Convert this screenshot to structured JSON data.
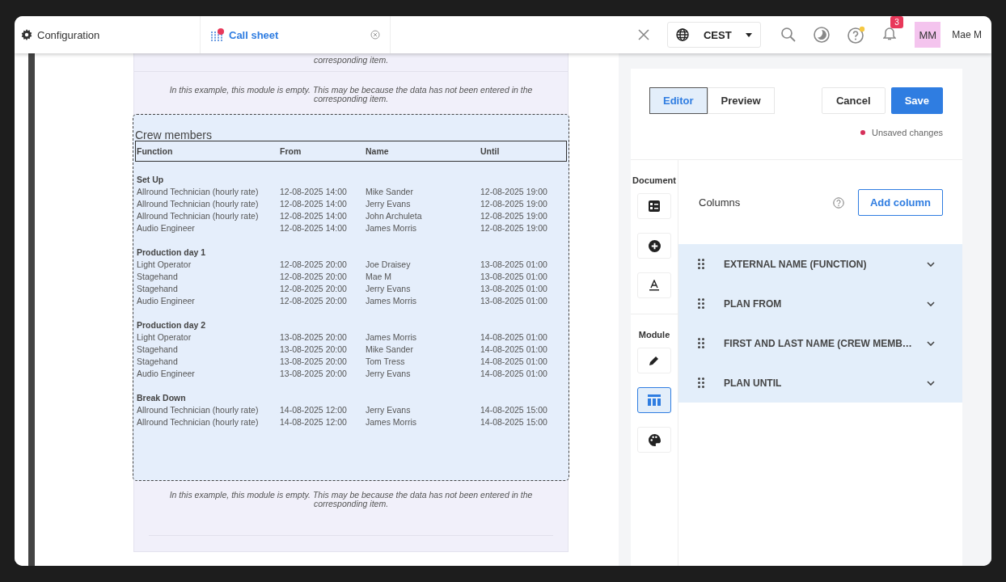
{
  "header": {
    "app": "Configuration",
    "tab": {
      "label": "Call sheet"
    },
    "timezone": "CEST",
    "notifications": "3",
    "avatar": "MM",
    "user": "Mae M"
  },
  "document": {
    "top_note": "corresponding item.",
    "note_before": "In this example, this module is empty. This may be because the data has not been entered in the corresponding item.",
    "module": {
      "title": "Crew members",
      "columns": [
        "Function",
        "From",
        "Name",
        "Until"
      ],
      "groups": [
        {
          "title": "Set Up",
          "rows": [
            [
              "Allround Technician (hourly rate)",
              "12-08-2025 14:00",
              "Mike Sander",
              "12-08-2025 19:00"
            ],
            [
              "Allround Technician (hourly rate)",
              "12-08-2025 14:00",
              "Jerry Evans",
              "12-08-2025 19:00"
            ],
            [
              "Allround Technician (hourly rate)",
              "12-08-2025 14:00",
              "John Archuleta",
              "12-08-2025 19:00"
            ],
            [
              "Audio Engineer",
              "12-08-2025 14:00",
              "James Morris",
              "12-08-2025 19:00"
            ]
          ]
        },
        {
          "title": "Production day 1",
          "rows": [
            [
              "Light Operator",
              "12-08-2025 20:00",
              "Joe Draisey",
              "13-08-2025 01:00"
            ],
            [
              "Stagehand",
              "12-08-2025 20:00",
              "Mae M",
              "13-08-2025 01:00"
            ],
            [
              "Stagehand",
              "12-08-2025 20:00",
              "Jerry Evans",
              "13-08-2025 01:00"
            ],
            [
              "Audio Engineer",
              "12-08-2025 20:00",
              "James Morris",
              "13-08-2025 01:00"
            ]
          ]
        },
        {
          "title": "Production day 2",
          "rows": [
            [
              "Light Operator",
              "13-08-2025 20:00",
              "James Morris",
              "14-08-2025 01:00"
            ],
            [
              "Stagehand",
              "13-08-2025 20:00",
              "Mike Sander",
              "14-08-2025 01:00"
            ],
            [
              "Stagehand",
              "13-08-2025 20:00",
              "Tom Tress",
              "14-08-2025 01:00"
            ],
            [
              "Audio Engineer",
              "13-08-2025 20:00",
              "Jerry Evans",
              "14-08-2025 01:00"
            ]
          ]
        },
        {
          "title": "Break Down",
          "rows": [
            [
              "Allround Technician (hourly rate)",
              "14-08-2025 12:00",
              "Jerry Evans",
              "14-08-2025 15:00"
            ],
            [
              "Allround Technician (hourly rate)",
              "14-08-2025 12:00",
              "James Morris",
              "14-08-2025 15:00"
            ]
          ]
        }
      ]
    },
    "note_after": "In this example, this module is empty. This may be because the data has not been entered in the corresponding item."
  },
  "panel": {
    "modes": [
      {
        "label": "Editor",
        "selected": true
      },
      {
        "label": "Preview",
        "selected": false
      }
    ],
    "cancel": "Cancel",
    "save": "Save",
    "status": "Unsaved changes",
    "tool_sections": [
      {
        "label": "Document",
        "tools": [
          {
            "kind": "list",
            "selected": false
          },
          {
            "kind": "add",
            "selected": false
          },
          {
            "kind": "text",
            "selected": false
          }
        ]
      },
      {
        "label": "Module",
        "tools": [
          {
            "kind": "edit",
            "selected": false
          },
          {
            "kind": "table",
            "selected": true
          },
          {
            "kind": "palette",
            "selected": false
          }
        ]
      }
    ],
    "columns_title": "Columns",
    "add_column": "Add column",
    "columns": [
      "EXTERNAL NAME (FUNCTION)",
      "PLAN FROM",
      "FIRST AND LAST NAME (CREW MEMB…",
      "PLAN UNTIL"
    ]
  }
}
